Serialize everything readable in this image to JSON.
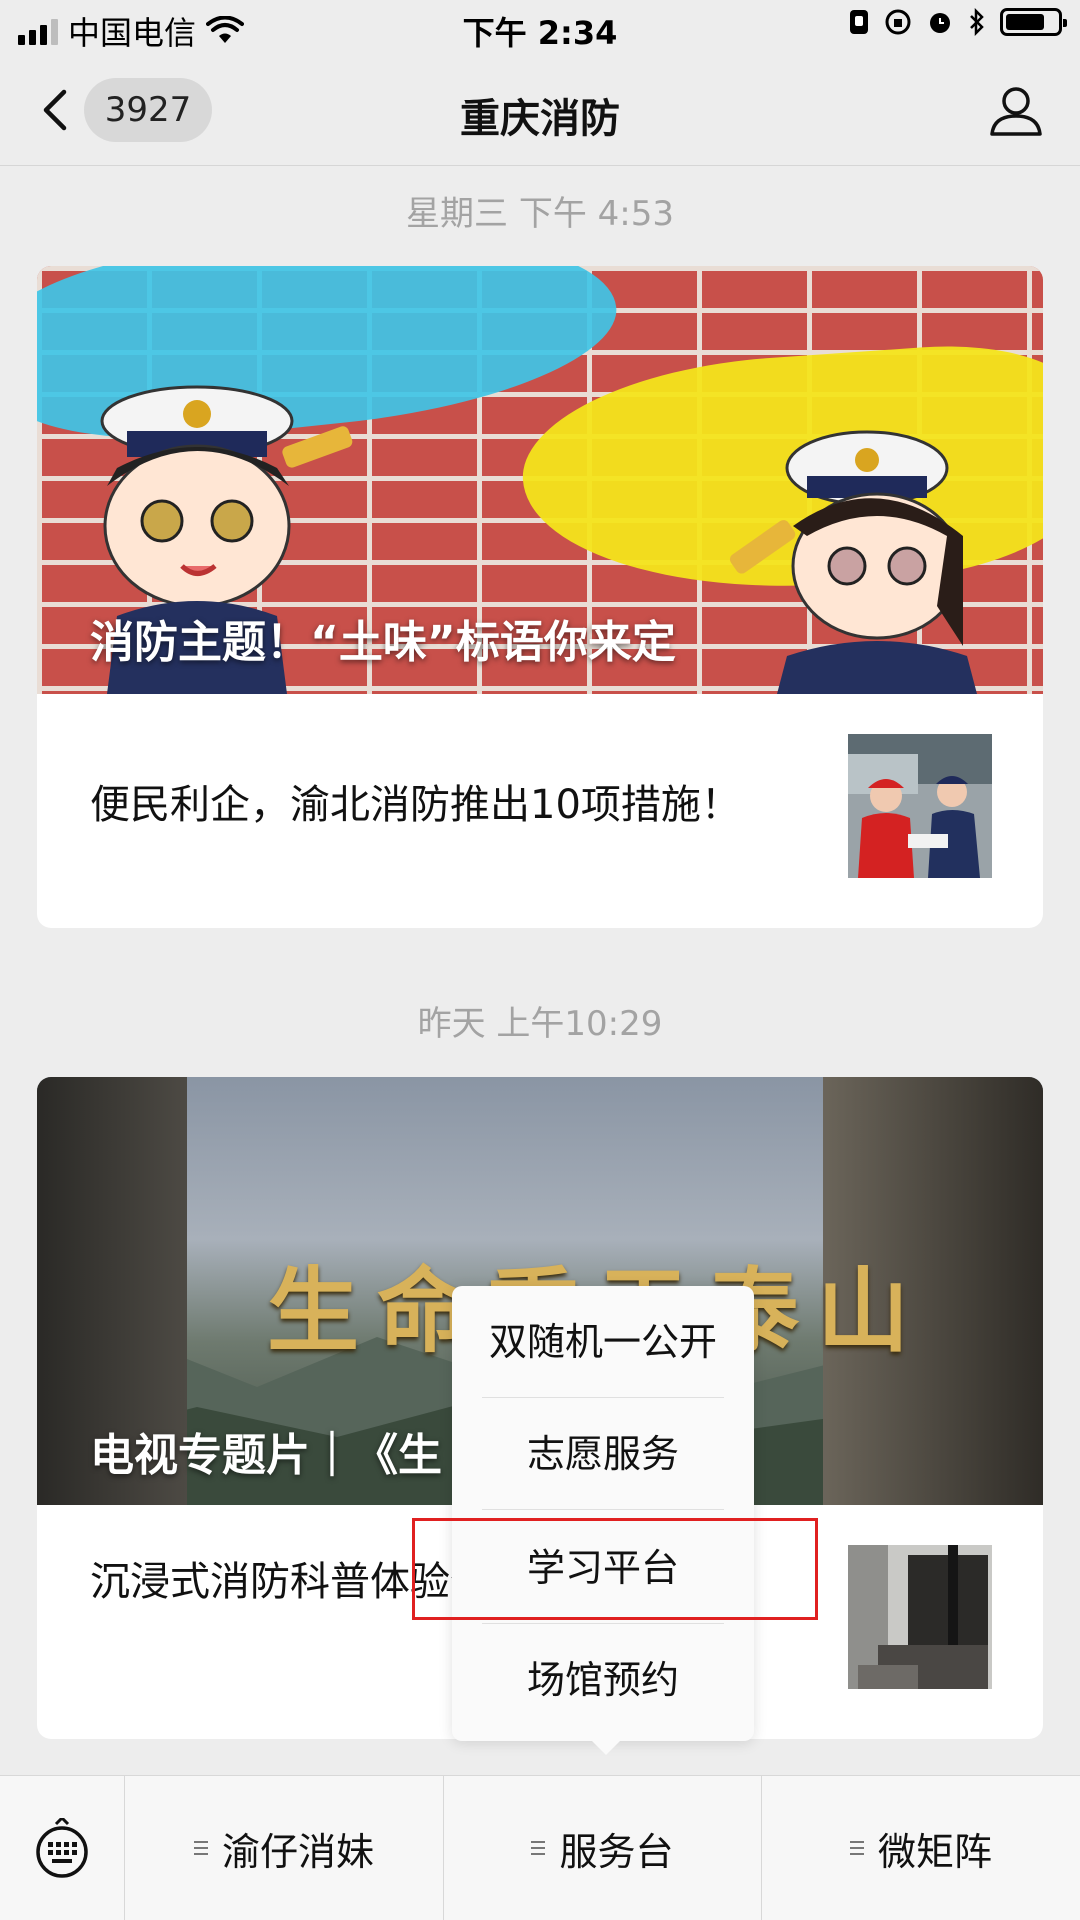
{
  "status_bar": {
    "carrier": "中国电信",
    "time": "下午 2:34"
  },
  "nav": {
    "unread_count": "3927",
    "title": "重庆消防"
  },
  "messages": [
    {
      "timestamp": "星期三 下午 4:53",
      "cover_title": "消防主题！“土味”标语你来定",
      "secondary_title": "便民利企，渝北消防推出10项措施！"
    },
    {
      "timestamp": "昨天 上午10:29",
      "cover_title": "电视专题片｜《生",
      "cover_calligraphy": "生命重于泰山",
      "secondary_title": "沉浸式消防科普体验何防范？"
    }
  ],
  "popup_menu": {
    "items": [
      "双随机一公开",
      "志愿服务",
      "学习平台",
      "场馆预约"
    ],
    "highlighted": "学习平台"
  },
  "bottom_menu": {
    "tabs": [
      "渝仔消妹",
      "服务台",
      "微矩阵"
    ]
  },
  "colors": {
    "highlight_border": "#e02020",
    "background": "#ededed"
  }
}
